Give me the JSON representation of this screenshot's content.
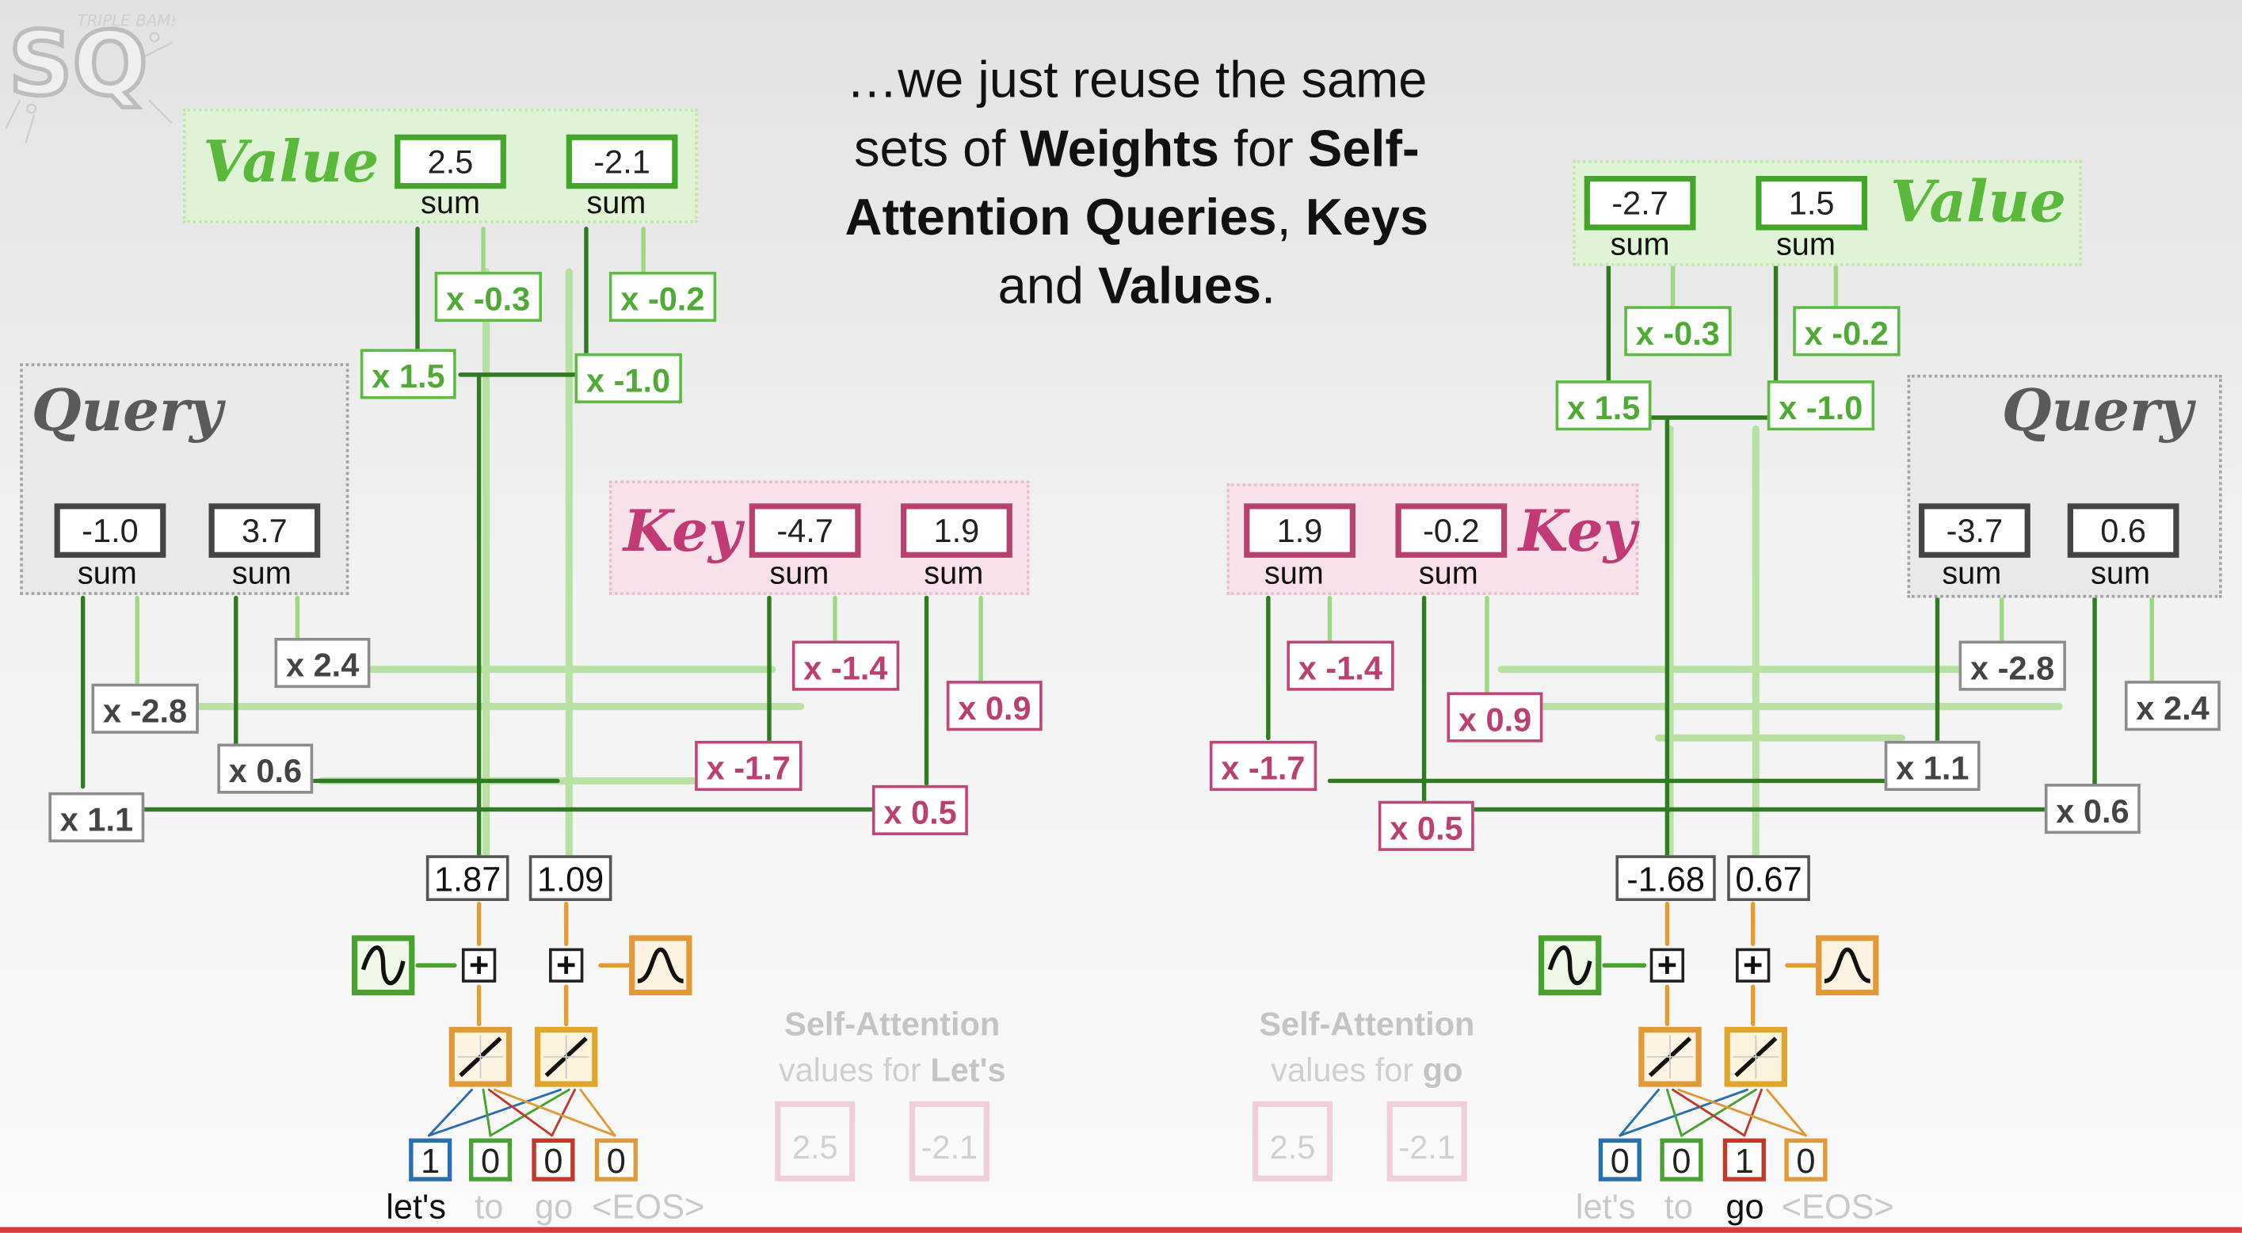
{
  "caption": {
    "line1": "…we just reuse the same",
    "line2_a": "sets of ",
    "line2_b": "Weights",
    "line2_c": " for ",
    "line2_d": "Self-",
    "line3_a": "Attention Queries",
    "line3_b": ", ",
    "line3_c": "Keys",
    "line4_a": "and ",
    "line4_b": "Values",
    "line4_c": "."
  },
  "logo": {
    "text": "SQ",
    "sub": "TRIPLE BAM!!!"
  },
  "sum_label": "sum",
  "left": {
    "value_title": "Value",
    "value_sums": [
      "2.5",
      "-2.1"
    ],
    "value_weights": [
      "x -0.3",
      "x -0.2",
      "x 1.5",
      "x -1.0"
    ],
    "query_title": "Query",
    "query_sums": [
      "-1.0",
      "3.7"
    ],
    "query_weights": [
      "x 2.4",
      "x -2.8",
      "x 0.6",
      "x 1.1"
    ],
    "key_title": "Key",
    "key_sums": [
      "-4.7",
      "1.9"
    ],
    "key_weights": [
      "x -1.4",
      "x 0.9",
      "x -1.7",
      "x 0.5"
    ],
    "encodings": [
      "1.87",
      "1.09"
    ],
    "plus": "+",
    "tokens": [
      "1",
      "0",
      "0",
      "0"
    ],
    "words": [
      "let's",
      "to",
      "go",
      "<EOS>"
    ]
  },
  "right": {
    "value_title": "Value",
    "value_sums": [
      "-2.7",
      "1.5"
    ],
    "value_weights": [
      "x -0.3",
      "x -0.2",
      "x 1.5",
      "x -1.0"
    ],
    "query_title": "Query",
    "query_sums": [
      "-3.7",
      "0.6"
    ],
    "query_weights": [
      "x -2.8",
      "x 2.4",
      "x 1.1",
      "x 0.6"
    ],
    "key_title": "Key",
    "key_sums": [
      "1.9",
      "-0.2"
    ],
    "key_weights": [
      "x -1.4",
      "x 0.9",
      "x -1.7",
      "x 0.5"
    ],
    "encodings": [
      "-1.68",
      "0.67"
    ],
    "plus": "+",
    "tokens": [
      "0",
      "0",
      "1",
      "0"
    ],
    "words": [
      "let's",
      "to",
      "go",
      "<EOS>"
    ]
  },
  "faded_left": {
    "line1": "Self-Attention",
    "line2_a": "values for ",
    "line2_b": "Let's",
    "vals": [
      "2.5",
      "-2.1"
    ]
  },
  "faded_right": {
    "line1": "Self-Attention",
    "line2_a": "values for ",
    "line2_b": "go",
    "vals": [
      "2.5",
      "-2.1"
    ]
  },
  "colors": {
    "value": "#5ab83c",
    "key": "#c23a75",
    "query": "#5a5a5a",
    "position": "#e09a37",
    "token_1": "#2c6fb0",
    "token_2": "#49a22f",
    "token_3": "#c0392b",
    "token_4": "#e09a37"
  }
}
